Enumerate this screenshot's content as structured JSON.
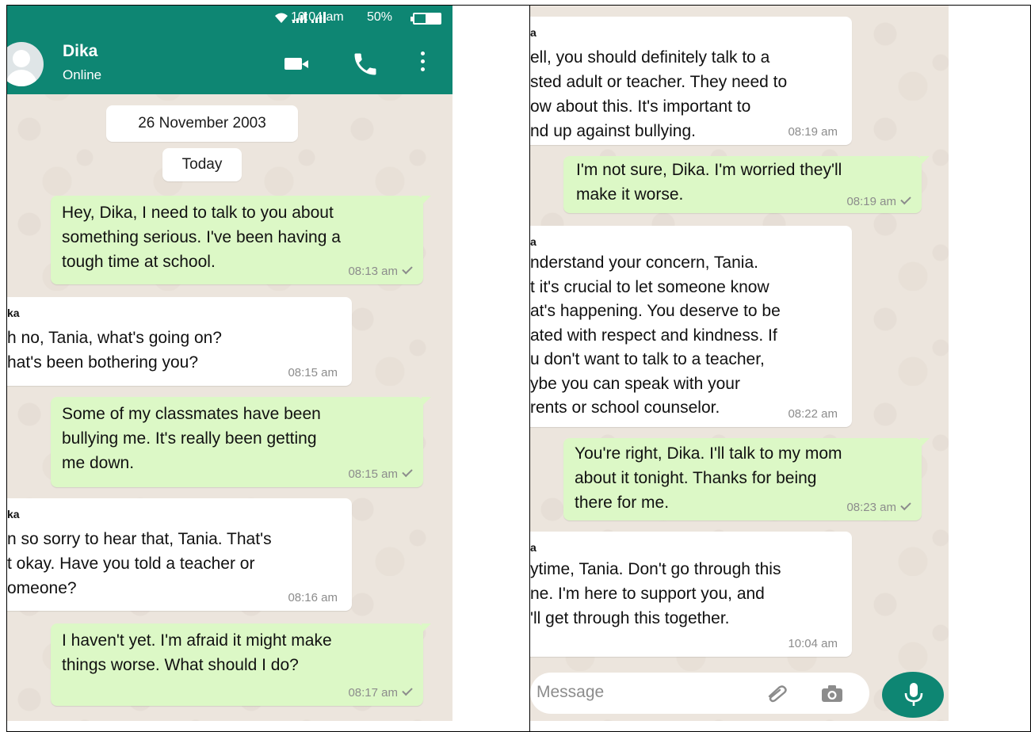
{
  "status_bar": {
    "time": "10:04 am",
    "battery": "50%",
    "battery_level": 0.5
  },
  "header": {
    "contact_name": "Dika",
    "contact_status": "Online"
  },
  "chat": {
    "date_label": "26 November 2003",
    "today_label": "Today",
    "left_messages": [
      {
        "dir": "out",
        "text": "Hey, Dika, I need to talk to you about\nsomething serious. I've been having a\ntough time at school.",
        "time": "08:13 am"
      },
      {
        "dir": "in",
        "sender": "ka",
        "text": "h no, Tania, what's going on?\nhat's been bothering you?",
        "time": "08:15 am"
      },
      {
        "dir": "out",
        "text": "Some of my classmates have been\nbullying me. It's really been getting\nme down.",
        "time": "08:15 am"
      },
      {
        "dir": "in",
        "sender": "ka",
        "text": "n so sorry to hear that, Tania. That's\nt okay. Have you told a teacher or\nomeone?",
        "time": "08:16 am"
      },
      {
        "dir": "out",
        "text": "I haven't yet. I'm afraid it might make\nthings worse. What should I do?",
        "time": "08:17 am"
      }
    ],
    "right_messages": [
      {
        "dir": "in",
        "sender": "a",
        "text": "ell, you should definitely talk to a\nsted adult or teacher. They need to\now about this. It's important to\nnd up against bullying.",
        "time": "08:19 am"
      },
      {
        "dir": "out",
        "text": "I'm not sure, Dika. I'm worried they'll\nmake it worse.",
        "time": "08:19 am"
      },
      {
        "dir": "in",
        "sender": "a",
        "text": "nderstand your concern, Tania.\nt it's crucial to let someone know\nat's happening. You deserve to be\nated with respect and kindness. If\nu don't want to talk to a teacher,\nybe you can speak with your\nrents or school counselor.",
        "time": "08:22 am"
      },
      {
        "dir": "out",
        "text": "You're right, Dika. I'll talk to my mom\nabout it tonight. Thanks for being\nthere for me.",
        "time": "08:23 am"
      },
      {
        "dir": "in",
        "sender": "a",
        "text": "ytime, Tania. Don't go through this\nne. I'm here to support you, and\n'll get through this together.",
        "time": "10:04 am"
      }
    ]
  },
  "composer": {
    "placeholder": "Message"
  },
  "icons": {
    "video": "video-camera-icon",
    "phone": "phone-icon",
    "menu": "more-vert-icon",
    "attach": "paperclip-icon",
    "camera": "camera-icon",
    "mic": "microphone-icon",
    "signal": "signal-icon",
    "wifi": "wifi-icon",
    "battery": "battery-icon"
  },
  "colors": {
    "header": "#0e8673",
    "outgoing": "#dcf8c6",
    "incoming": "#ffffff",
    "chat_bg": "#ece5dd"
  }
}
